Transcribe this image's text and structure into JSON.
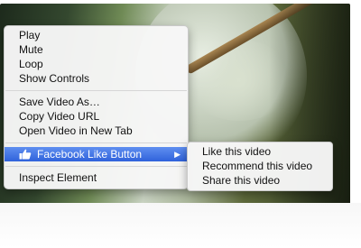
{
  "context_menu": {
    "items": [
      {
        "label": "Play"
      },
      {
        "label": "Mute"
      },
      {
        "label": "Loop"
      },
      {
        "label": "Show Controls"
      },
      {
        "label": "Save Video As…"
      },
      {
        "label": "Copy Video URL"
      },
      {
        "label": "Open Video in New Tab"
      },
      {
        "label": "Facebook Like Button"
      },
      {
        "label": "Inspect Element"
      }
    ],
    "submenu_arrow": "▶",
    "highlight_color": "#3a6fe2"
  },
  "submenu": {
    "items": [
      {
        "label": "Like this video"
      },
      {
        "label": "Recommend this video"
      },
      {
        "label": "Share this video"
      }
    ]
  },
  "icons": {
    "facebook": "thumbs-up-icon"
  }
}
